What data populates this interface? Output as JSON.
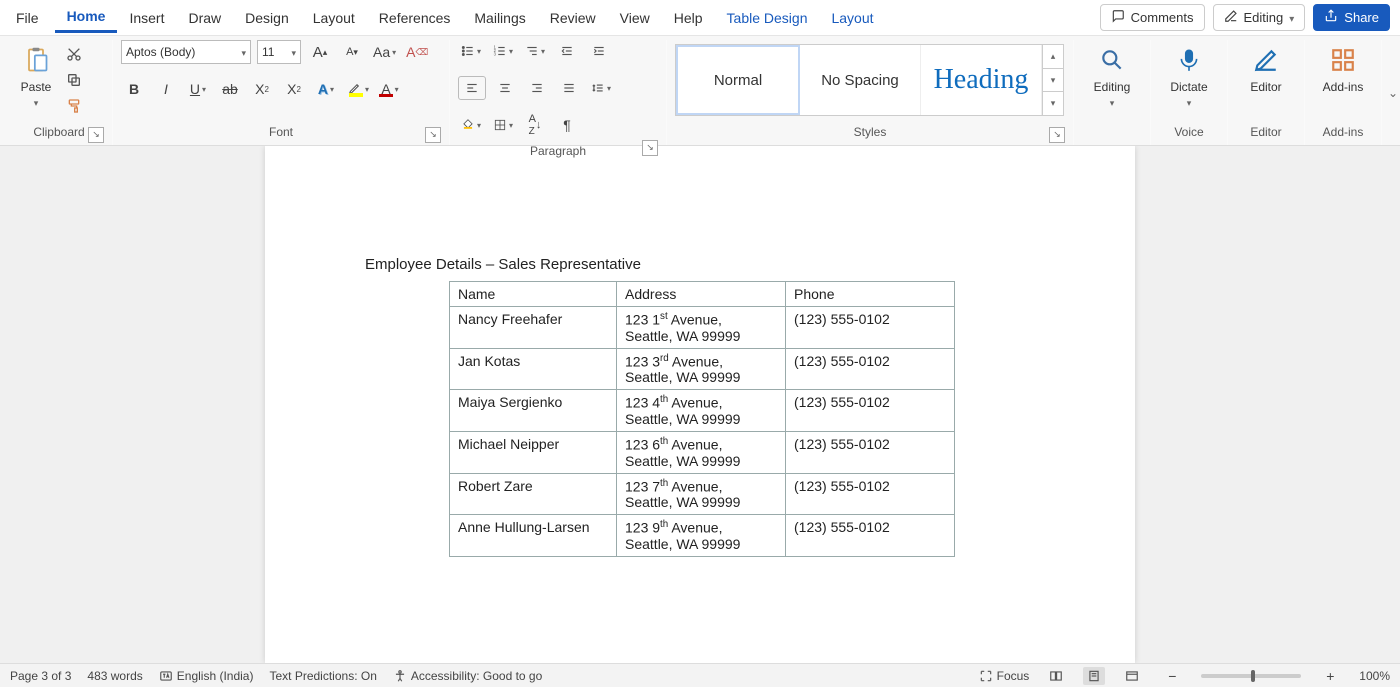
{
  "menu": {
    "file": "File",
    "tabs": [
      "Home",
      "Insert",
      "Draw",
      "Design",
      "Layout",
      "References",
      "Mailings",
      "Review",
      "View",
      "Help",
      "Table Design",
      "Layout"
    ],
    "active_index": 0,
    "accent_indices": [
      10,
      11
    ],
    "comments": "Comments",
    "editing": "Editing",
    "share": "Share"
  },
  "ribbon": {
    "clipboard": {
      "paste": "Paste",
      "label": "Clipboard"
    },
    "font": {
      "name": "Aptos (Body)",
      "size": "11",
      "label": "Font"
    },
    "paragraph": {
      "label": "Paragraph"
    },
    "styles": {
      "label": "Styles",
      "items": [
        "Normal",
        "No Spacing",
        "Heading"
      ]
    },
    "editing_group": {
      "editing": "Editing"
    },
    "voice": {
      "dictate": "Dictate",
      "label": "Voice"
    },
    "editor": {
      "editor": "Editor",
      "label": "Editor"
    },
    "addins": {
      "addins": "Add-ins",
      "label": "Add-ins"
    }
  },
  "doc": {
    "heading": "Employee Details – Sales Representative",
    "cols": [
      "Name",
      "Address",
      "Phone"
    ],
    "rows": [
      {
        "name": "Nancy Freehafer",
        "addr_pre": "123 1",
        "addr_sup": "st",
        "addr_post": " Avenue,",
        "addr2": "Seattle, WA 99999",
        "phone": "(123) 555-0102"
      },
      {
        "name": "Jan Kotas",
        "addr_pre": "123 3",
        "addr_sup": "rd",
        "addr_post": " Avenue,",
        "addr2": "Seattle, WA 99999",
        "phone": "(123) 555-0102"
      },
      {
        "name": "Maiya Sergienko",
        "addr_pre": "123 4",
        "addr_sup": "th",
        "addr_post": " Avenue,",
        "addr2": "Seattle, WA 99999",
        "phone": "(123) 555-0102"
      },
      {
        "name": "Michael Neipper",
        "addr_pre": "123 6",
        "addr_sup": "th",
        "addr_post": " Avenue,",
        "addr2": "Seattle, WA 99999",
        "phone": "(123) 555-0102"
      },
      {
        "name": "Robert Zare",
        "addr_pre": "123 7",
        "addr_sup": "th",
        "addr_post": " Avenue,",
        "addr2": "Seattle, WA 99999",
        "phone": "(123) 555-0102"
      },
      {
        "name": "Anne Hullung-Larsen",
        "addr_pre": "123 9",
        "addr_sup": "th",
        "addr_post": " Avenue,",
        "addr2": "Seattle, WA 99999",
        "phone": "(123) 555-0102"
      }
    ]
  },
  "status": {
    "page": "Page 3 of 3",
    "words": "483 words",
    "lang": "English (India)",
    "predictions": "Text Predictions: On",
    "accessibility": "Accessibility: Good to go",
    "focus": "Focus",
    "zoom": "100%"
  }
}
